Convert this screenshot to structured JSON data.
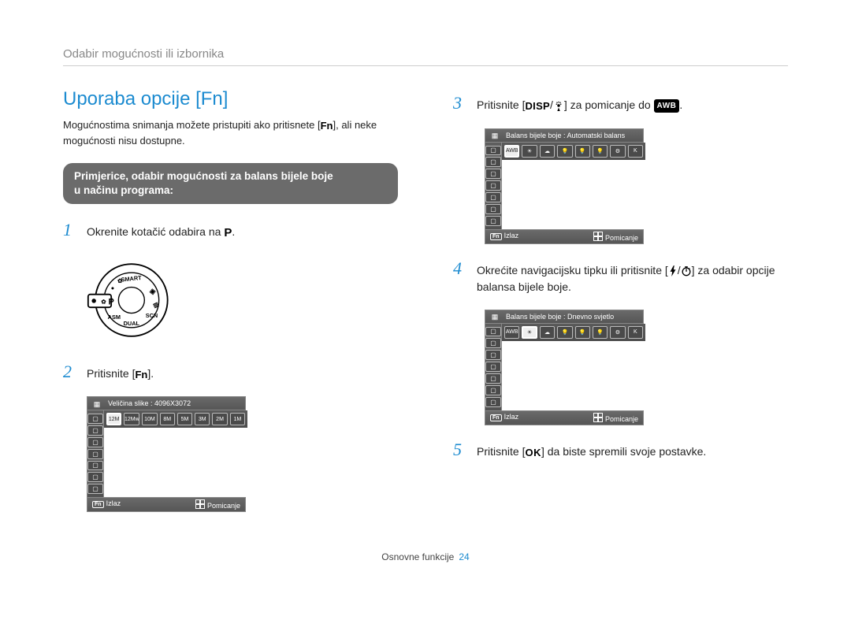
{
  "breadcrumb": "Odabir mogućnosti ili izbornika",
  "section_title": "Uporaba opcije [Fn]",
  "intro": {
    "a": "Mogućnostima snimanja možete pristupiti ako pritisnete [",
    "fn": "Fn",
    "b": "], ali neke mogućnosti nisu dostupne."
  },
  "pill": {
    "line1": "Primjerice, odabir mogućnosti za balans bijele boje",
    "line2": "u načinu programa:"
  },
  "dial_modes": [
    "SMART",
    "DUAL",
    "ASM",
    "SCN"
  ],
  "steps": {
    "s1": {
      "n": "1",
      "a": "Okrenite kotačić odabira na ",
      "p": "P",
      "b": "."
    },
    "s2": {
      "n": "2",
      "a": "Pritisnite [",
      "fn": "Fn",
      "b": "]."
    },
    "s3": {
      "n": "3",
      "a": "Pritisnite [",
      "disp": "DISP",
      "mid": "/",
      "c": "] za pomicanje do ",
      "awb": "AWB",
      "d": "."
    },
    "s4": {
      "n": "4",
      "a": "Okrećite navigacijsku tipku ili pritisnite [",
      "mid": "/",
      "b": "] za odabir opcije balansa bijele boje."
    },
    "s5": {
      "n": "5",
      "a": "Pritisnite [",
      "ok": "OK",
      "b": "] da biste spremili svoje postavke."
    }
  },
  "lcd1": {
    "header": "Veličina slike : 4096X3072",
    "left_icons": [
      "iso-icon",
      "size-icon",
      "ev-icon",
      "wb-icon",
      "focus-icon",
      "flash-icon",
      "stabilizer-icon"
    ],
    "row": [
      "12M",
      "12Mw",
      "10M",
      "8M",
      "5M",
      "3M",
      "2M",
      "1M"
    ],
    "active": 0,
    "footer_left_badge": "Fn",
    "footer_left": "Izlaz",
    "footer_right": "Pomicanje"
  },
  "lcd2": {
    "header": "Balans bijele boje : Automatski balans",
    "left_icons": [
      "iso-icon",
      "wb-icon",
      "ev-icon",
      "face-icon",
      "plus-icon",
      "flash-icon",
      "stabilizer-icon"
    ],
    "row": [
      "AWB",
      "☀",
      "☁",
      "💡",
      "💡",
      "💡",
      "⚙",
      "K"
    ],
    "active": 0,
    "footer_left_badge": "Fn",
    "footer_left": "Izlaz",
    "footer_right": "Pomicanje"
  },
  "lcd3": {
    "header": "Balans bijele boje : Dnevno svjetlo",
    "left_icons": [
      "iso-icon",
      "wb-icon",
      "ev-icon",
      "face-icon",
      "plus-icon",
      "flash-icon",
      "stabilizer-icon"
    ],
    "row": [
      "AWB",
      "☀",
      "☁",
      "💡",
      "💡",
      "💡",
      "⚙",
      "K"
    ],
    "active": 1,
    "footer_left_badge": "Fn",
    "footer_left": "Izlaz",
    "footer_right": "Pomicanje"
  },
  "footer": {
    "label": "Osnovne funkcije",
    "page": "24"
  }
}
